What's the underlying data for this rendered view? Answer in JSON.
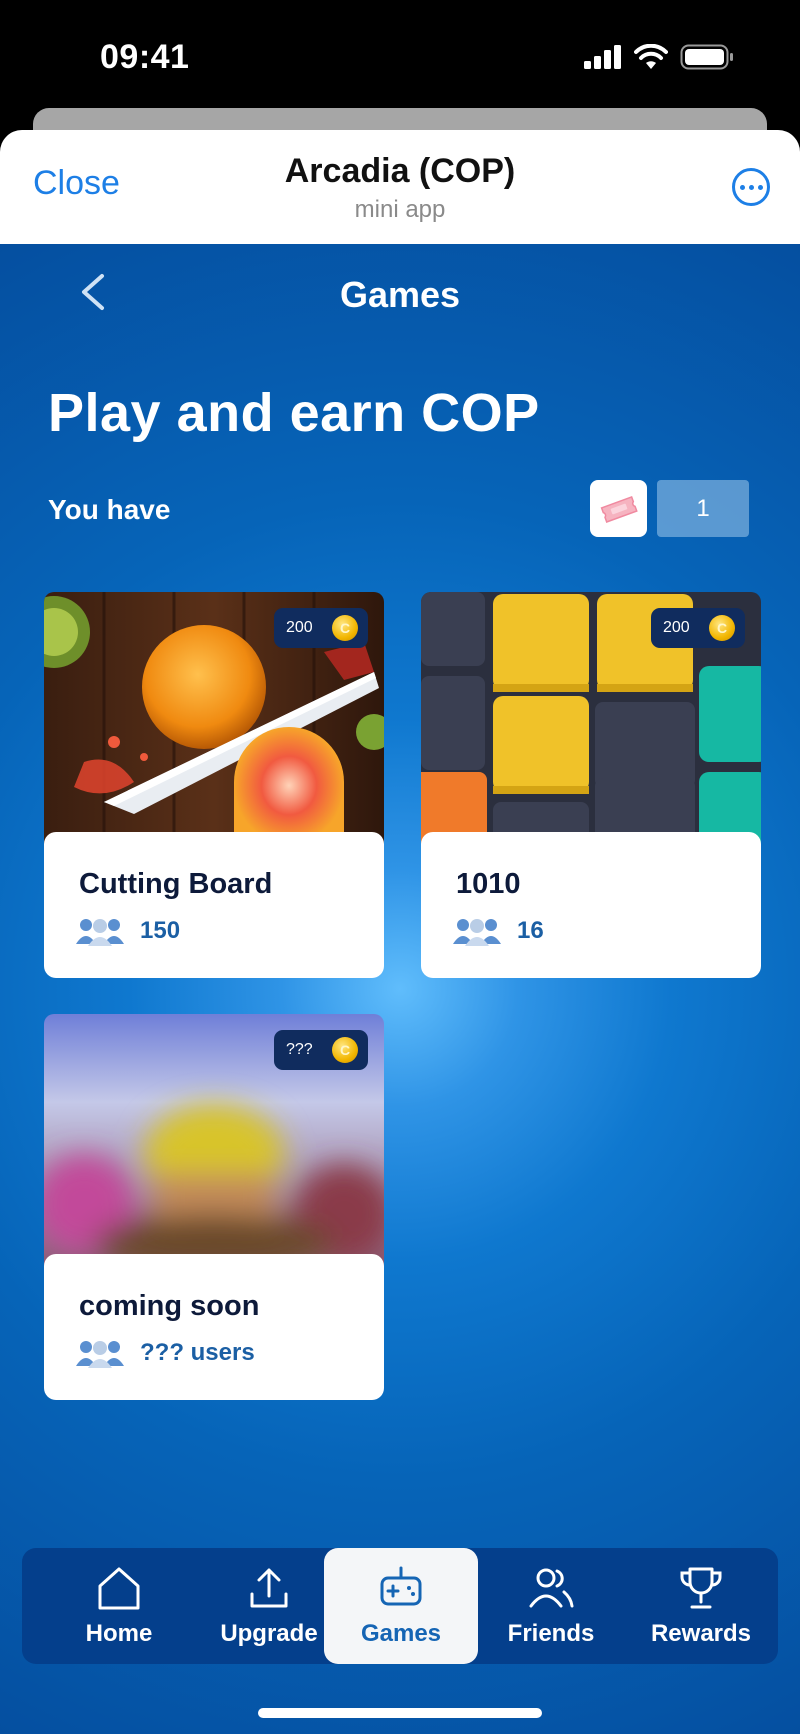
{
  "status_bar": {
    "time": "09:41"
  },
  "header": {
    "close_label": "Close",
    "title": "Arcadia (COP)",
    "subtitle": "mini app",
    "more_icon": "ellipsis-circle-icon"
  },
  "page": {
    "title": "Games",
    "headline": "Play and earn COP",
    "you_have_label": "You have",
    "ticket_count": "1"
  },
  "games": [
    {
      "title": "Cutting Board",
      "users": "150",
      "reward": "200"
    },
    {
      "title": "1010",
      "users": "16",
      "reward": "200"
    },
    {
      "title": "coming soon",
      "users": "??? users",
      "reward": "???"
    }
  ],
  "coin_letter": "C",
  "nav": {
    "items": [
      {
        "label": "Home",
        "icon": "home-icon"
      },
      {
        "label": "Upgrade",
        "icon": "upload-icon"
      },
      {
        "label": "Games",
        "icon": "gamepad-icon",
        "active": true
      },
      {
        "label": "Friends",
        "icon": "users-icon"
      },
      {
        "label": "Rewards",
        "icon": "trophy-icon"
      }
    ]
  },
  "colors": {
    "accent_blue": "#1d7fe6",
    "background_blue": "#0664b8",
    "nav_bg": "#043f8c",
    "active_nav_text": "#1565b4"
  }
}
